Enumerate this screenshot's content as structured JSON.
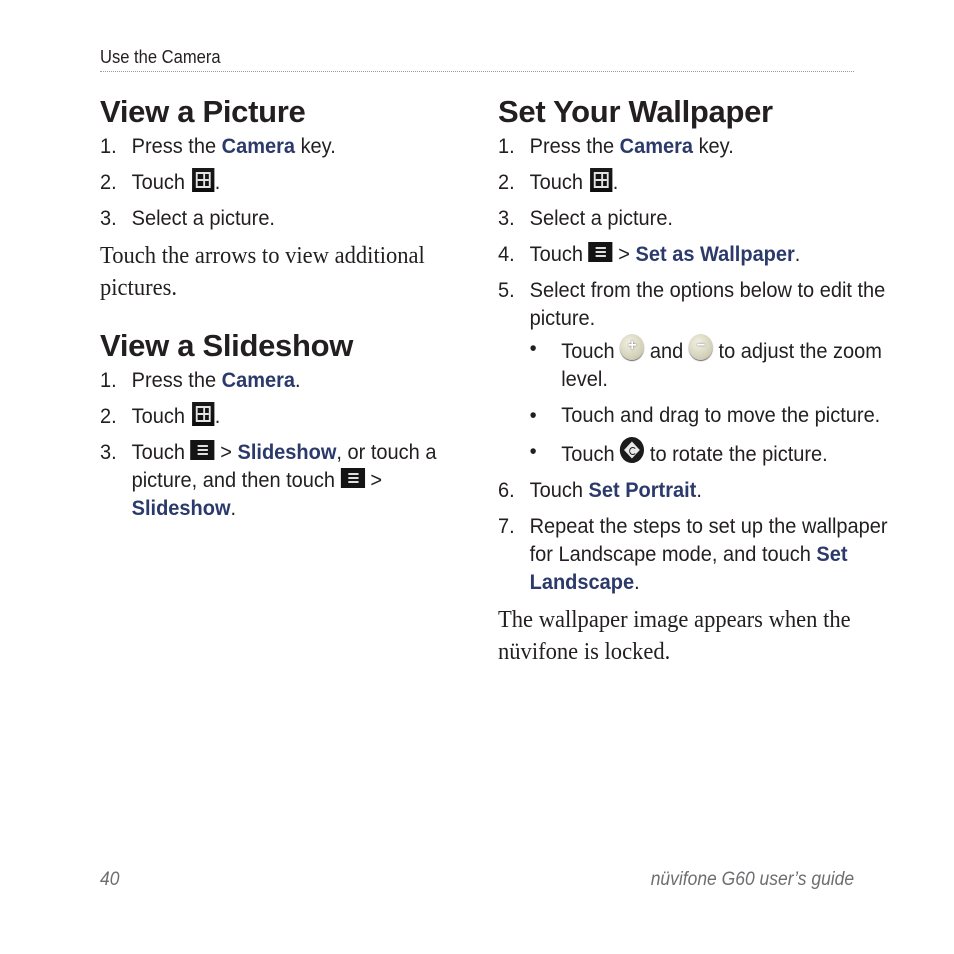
{
  "header": {
    "section_title": "Use the Camera"
  },
  "colors": {
    "keyword": "#2b3a6b",
    "text": "#231f20",
    "footer": "#6d6e71"
  },
  "left": {
    "view_picture": {
      "title": "View a Picture",
      "steps": [
        {
          "num": "1.",
          "pre": "Press the ",
          "kw": "Camera",
          "post": " key."
        },
        {
          "num": "2.",
          "pre": "Touch ",
          "icon": "gallery-grid-icon",
          "post": "."
        },
        {
          "num": "3.",
          "text": "Select a picture."
        }
      ],
      "note": "Touch the arrows to view additional pictures."
    },
    "view_slideshow": {
      "title": "View a Slideshow",
      "steps": [
        {
          "num": "1.",
          "pre": "Press the ",
          "kw": "Camera",
          "post": "."
        },
        {
          "num": "2.",
          "pre": "Touch ",
          "icon": "gallery-grid-icon",
          "post": "."
        },
        {
          "num": "3.",
          "pre": "Touch ",
          "icon": "menu-icon",
          "sep": " > ",
          "kw": "Slideshow",
          "mid": ", or touch a picture, and then touch ",
          "icon2": "menu-icon",
          "sep2": " > ",
          "kw2": "Slideshow",
          "post": "."
        }
      ]
    }
  },
  "right": {
    "set_wallpaper": {
      "title": "Set Your Wallpaper",
      "steps": [
        {
          "num": "1.",
          "pre": "Press the ",
          "kw": "Camera",
          "post": " key."
        },
        {
          "num": "2.",
          "pre": "Touch ",
          "icon": "gallery-grid-icon",
          "post": "."
        },
        {
          "num": "3.",
          "text": "Select a picture."
        },
        {
          "num": "4.",
          "pre": "Touch ",
          "icon": "menu-icon",
          "sep": " > ",
          "kw": "Set as Wallpaper",
          "post": "."
        },
        {
          "num": "5.",
          "text": "Select from the options below to edit the picture."
        },
        {
          "num": "6.",
          "pre": "Touch ",
          "kw": "Set Portrait",
          "post": "."
        },
        {
          "num": "7.",
          "pre": "Repeat the steps to set up the wallpaper for Landscape mode, and touch ",
          "kw": "Set Landscape",
          "post": "."
        }
      ],
      "bullets": [
        {
          "pre": "Touch ",
          "icon": "zoom-in-icon",
          "mid": " and ",
          "icon2": "zoom-out-icon",
          "post": " to adjust the zoom level."
        },
        {
          "text": "Touch and drag to move the picture."
        },
        {
          "pre": "Touch ",
          "icon": "rotate-icon",
          "post": " to rotate the picture."
        }
      ],
      "note": "The wallpaper image appears when the nüvifone is locked."
    }
  },
  "footer": {
    "page_number": "40",
    "guide_title": "nüvifone G60 user’s guide"
  }
}
